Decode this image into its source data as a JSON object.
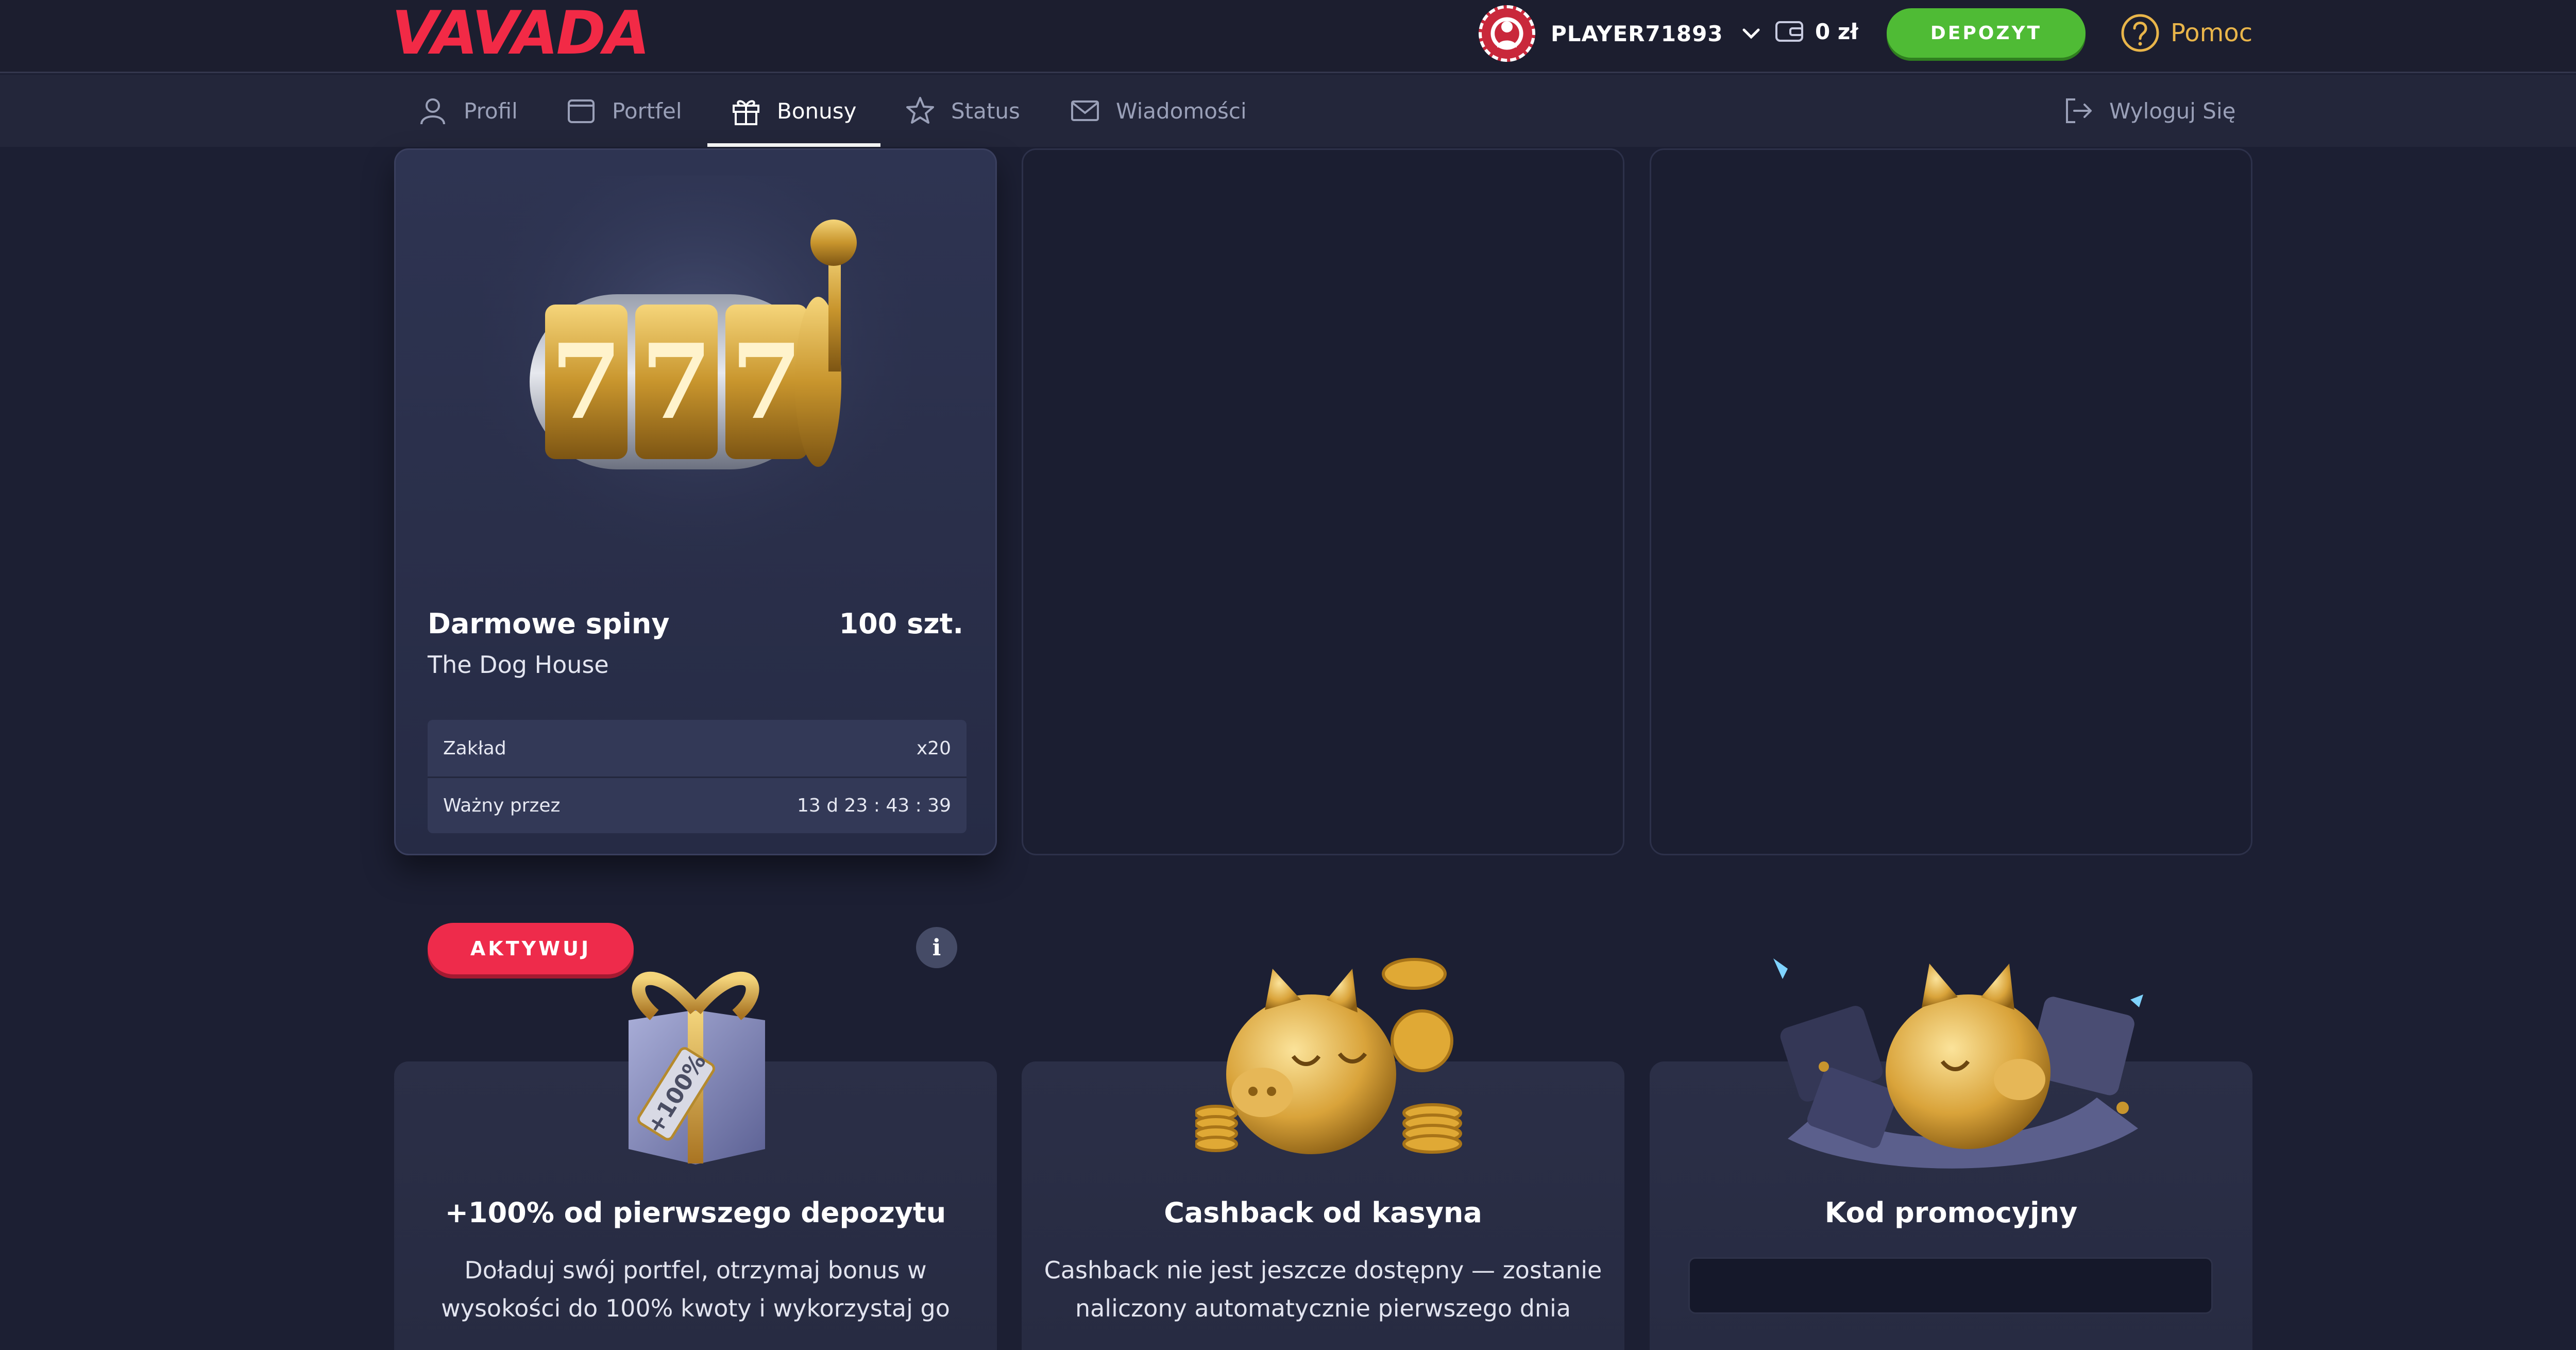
{
  "header": {
    "logo": "VAVADA",
    "username": "PLAYER71893",
    "balance": "0 zł",
    "deposit_label": "DEPOZYT",
    "help_label": "Pomoc"
  },
  "nav": {
    "items": [
      {
        "label": "Profil",
        "icon": "user-icon"
      },
      {
        "label": "Portfel",
        "icon": "wallet-icon"
      },
      {
        "label": "Bonusy",
        "icon": "gift-icon",
        "active": true
      },
      {
        "label": "Status",
        "icon": "star-icon"
      },
      {
        "label": "Wiadomości",
        "icon": "envelope-icon"
      }
    ],
    "logout_label": "Wyloguj Się"
  },
  "bonus_card": {
    "title": "Darmowe spiny",
    "amount": "100 szt.",
    "game": "The Dog House",
    "rows": [
      {
        "label": "Zakład",
        "value": "x20"
      },
      {
        "label": "Ważny przez",
        "value": "13 d 23 : 43 : 39"
      }
    ],
    "activate_label": "AKTYWUJ",
    "info_label": "i"
  },
  "promos": [
    {
      "title": "+100% od pierwszego depozytu",
      "desc_lines": [
        "Doładuj swój portfel, otrzymaj bonus w",
        "wysokości do 100% kwoty i wykorzystaj go"
      ],
      "art_text": "+100%"
    },
    {
      "title": "Cashback od kasyna",
      "desc_lines": [
        "Cashback nie jest jeszcze dostępny — zostanie",
        "naliczony automatycznie pierwszego dnia"
      ]
    },
    {
      "title": "Kod promocyjny",
      "input_value": ""
    }
  ],
  "colors": {
    "brand": "#f22a46",
    "deposit_green": "#4fbb35",
    "help_gold": "#e9b54a",
    "activate_red": "#ee2b4b",
    "background": "#1c1f33"
  }
}
